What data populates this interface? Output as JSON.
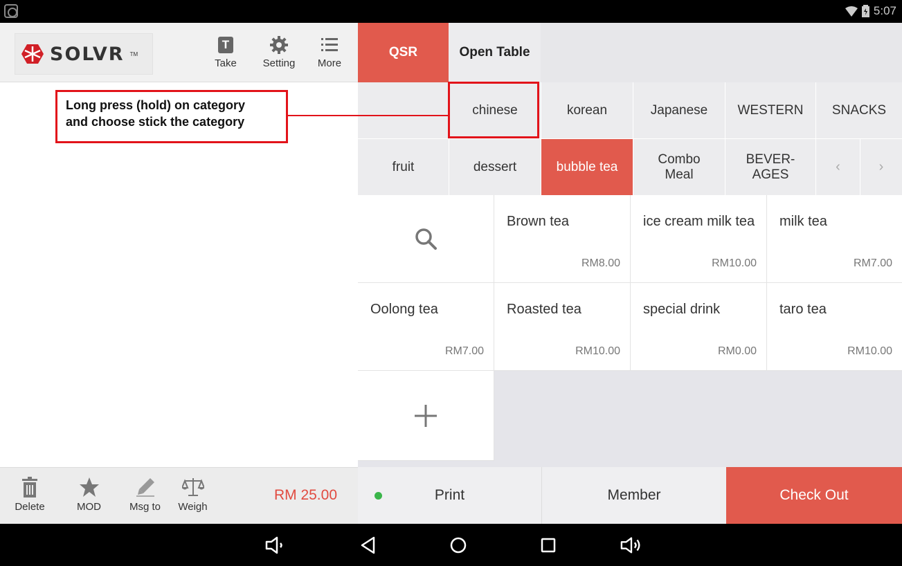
{
  "status_bar": {
    "time": "5:07"
  },
  "brand": {
    "logo": "SOLVR",
    "trademark": "TM"
  },
  "header_buttons": {
    "take": "Take",
    "setting": "Setting",
    "more": "More"
  },
  "tabs": [
    {
      "label": "QSR",
      "active": true
    },
    {
      "label": "Open Table",
      "active": false
    }
  ],
  "categories_row1": [
    "chinese",
    "korean",
    "Japanese",
    "WESTERN",
    "SNACKS"
  ],
  "categories_row2": [
    {
      "label": "fruit"
    },
    {
      "label": "dessert"
    },
    {
      "label": "bubble tea",
      "active": true
    },
    {
      "label": "Combo Meal"
    },
    {
      "label": "BEVER- AGES"
    }
  ],
  "products": [
    {
      "name": "Brown tea",
      "price": "RM8.00"
    },
    {
      "name": "ice cream milk tea",
      "price": "RM10.00"
    },
    {
      "name": "milk tea",
      "price": "RM7.00"
    },
    {
      "name": "Oolong tea",
      "price": "RM7.00"
    },
    {
      "name": "Roasted tea",
      "price": "RM10.00"
    },
    {
      "name": "special drink",
      "price": "RM0.00"
    },
    {
      "name": "taro tea",
      "price": "RM10.00"
    }
  ],
  "bottom_buttons": {
    "delete": "Delete",
    "mod": "MOD",
    "msg": "Msg to",
    "weigh": "Weigh"
  },
  "total": "RM 25.00",
  "actions": {
    "print": "Print",
    "member": "Member",
    "checkout": "Check Out"
  },
  "annotation": {
    "line1": "Long press (hold) on category",
    "line2": "and choose stick the category"
  },
  "colors": {
    "accent": "#e15a4d",
    "annotation": "#e2131a",
    "status_dot": "#3ab54a"
  }
}
